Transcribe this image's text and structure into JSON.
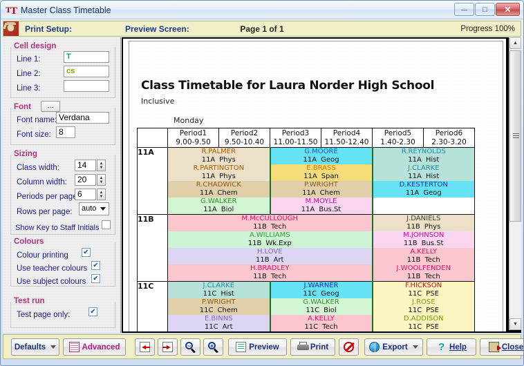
{
  "window": {
    "title": "Master Class Timetable",
    "app_icon": "tt-logo-icon",
    "minimize_glyph": "—",
    "maximize_glyph": "□",
    "close_glyph": "✕"
  },
  "header": {
    "print_setup_label": "Print Setup:",
    "preview_screen_label": "Preview Screen:",
    "page_label": "Page 1 of 1",
    "progress_label": "Progress 100%"
  },
  "sidebar": {
    "cell_design": {
      "title": "Cell design",
      "fields": [
        {
          "label": "Line 1:",
          "value": "T",
          "color": "#00a08a"
        },
        {
          "label": "Line 2:",
          "value": "cs",
          "color": "#8aa000"
        },
        {
          "label": "Line 3:",
          "value": "",
          "color": "#000000"
        }
      ]
    },
    "font": {
      "title": "Font",
      "browse_label": "...",
      "name_label": "Font name:",
      "name_value": "Verdana",
      "size_label": "Font size:",
      "size_value": "8"
    },
    "sizing": {
      "title": "Sizing",
      "class_width_label": "Class width:",
      "class_width_value": "14",
      "column_width_label": "Column width:",
      "column_width_value": "20",
      "periods_label": "Periods per page:",
      "periods_value": "6",
      "rows_label": "Rows per page:",
      "rows_value": "auto",
      "show_key_label": "Show Key to Staff Initials",
      "show_key_checked": false
    },
    "colours": {
      "title": "Colours",
      "items": [
        {
          "label": "Colour printing",
          "checked": true
        },
        {
          "label": "Use teacher colours",
          "checked": true
        },
        {
          "label": "Use subject colours",
          "checked": true
        }
      ]
    },
    "test_run": {
      "title": "Test run",
      "label": "Test page only:",
      "checked": true
    }
  },
  "document": {
    "title": "Class Timetable for Laura Norder High School",
    "subtitle": "Inclusive",
    "day_label": "Monday",
    "periods": [
      {
        "name": "Period1",
        "time": "9.00-9.50"
      },
      {
        "name": "Period2",
        "time": "9.50-10.40"
      },
      {
        "name": "Period3",
        "time": "11.00-11.50"
      },
      {
        "name": "Period4",
        "time": "11.50-12.40"
      },
      {
        "name": "Period5",
        "time": "1.40-2.30"
      },
      {
        "name": "Period6",
        "time": "2.30-3.20"
      }
    ],
    "rows": [
      {
        "class": "11A",
        "blocks": [
          {
            "span": 2,
            "lessons": [
              {
                "teacher": "R.PALMER",
                "class": "11A",
                "subject": "Phys",
                "bg": "#ede0c8",
                "fg": "#a06000"
              },
              {
                "teacher": "R.PARTINGTON",
                "class": "11A",
                "subject": "Phys",
                "bg": "#ede0c8",
                "fg": "#a06000"
              },
              {
                "teacher": "R.CHADWICK",
                "class": "11A",
                "subject": "Chem",
                "bg": "#e0cfa8",
                "fg": "#8a5a10"
              },
              {
                "teacher": "G.WALKER",
                "class": "11A",
                "subject": "Biol",
                "bg": "#d4f5d4",
                "fg": "#2f8f2f"
              }
            ]
          },
          {
            "span": 2,
            "lessons": [
              {
                "teacher": "G.MOORE",
                "class": "11A",
                "subject": "Geog",
                "bg": "#66e2f5",
                "fg": "#1560b0"
              },
              {
                "teacher": "E.BRASS",
                "class": "11A",
                "subject": "Span",
                "bg": "#f5dd7a",
                "fg": "#e07000"
              },
              {
                "teacher": "P.WRIGHT",
                "class": "11A",
                "subject": "Chem",
                "bg": "#e0cfa8",
                "fg": "#8a5a10"
              },
              {
                "teacher": "M.MOYLE",
                "class": "11A",
                "subject": "Bus.St",
                "bg": "#fcd6f0",
                "fg": "#c0109a"
              }
            ]
          },
          {
            "span": 2,
            "lessons": [
              {
                "teacher": "R.REYNOLDS",
                "class": "11A",
                "subject": "Hist",
                "bg": "#b6e2da",
                "fg": "#1e8fa8"
              },
              {
                "teacher": "J.CLARKE",
                "class": "11A",
                "subject": "Hist",
                "bg": "#b6e2da",
                "fg": "#1e8fa8"
              },
              {
                "teacher": "D.KESTERTON",
                "class": "11A",
                "subject": "Geog",
                "bg": "#66e2f5",
                "fg": "#1030c0"
              },
              {
                "teacher": "",
                "class": "",
                "subject": "",
                "bg": "#ffffff",
                "fg": "#ffffff"
              }
            ]
          }
        ]
      },
      {
        "class": "11B",
        "blocks": [
          {
            "span": 4,
            "lessons": [
              {
                "teacher": "M.McCULLOUGH",
                "class": "11B",
                "subject": "Tech",
                "bg": "#fcc6cf",
                "fg": "#e01070"
              },
              {
                "teacher": "A.WILLIAMS",
                "class": "11B",
                "subject": "Wk.Exp",
                "bg": "#cdf3d5",
                "fg": "#3a9a3a"
              },
              {
                "teacher": "H.LOVE",
                "class": "11B",
                "subject": "Art",
                "bg": "#ded5f5",
                "fg": "#7a6ab0"
              },
              {
                "teacher": "H.BRADLEY",
                "class": "11B",
                "subject": "Tech",
                "bg": "#fcc6cf",
                "fg": "#e01070"
              }
            ]
          },
          {
            "span": 2,
            "lessons": [
              {
                "teacher": "J.DANIELS",
                "class": "11B",
                "subject": "Phys",
                "bg": "#ede0c8",
                "fg": "#3a3a3a"
              },
              {
                "teacher": "M.JOHNSON",
                "class": "11B",
                "subject": "Bus.St",
                "bg": "#fcd6f0",
                "fg": "#c0109a"
              },
              {
                "teacher": "A.KELLY",
                "class": "11B",
                "subject": "Tech",
                "bg": "#fcc6cf",
                "fg": "#e01070"
              },
              {
                "teacher": "J.WOOLFENDEN",
                "class": "11B",
                "subject": "Tech",
                "bg": "#fcc6cf",
                "fg": "#e01070"
              }
            ]
          }
        ]
      },
      {
        "class": "11C",
        "blocks": [
          {
            "span": 2,
            "lessons": [
              {
                "teacher": "J.CLARKE",
                "class": "11C",
                "subject": "Hist",
                "bg": "#b6e2da",
                "fg": "#1e8fa8"
              },
              {
                "teacher": "P.WRIGHT",
                "class": "11C",
                "subject": "Chem",
                "bg": "#e0cfa8",
                "fg": "#8a5a10"
              },
              {
                "teacher": "E.BINNS",
                "class": "11C",
                "subject": "Art",
                "bg": "#ded5f5",
                "fg": "#7a6ab0"
              }
            ]
          },
          {
            "span": 2,
            "lessons": [
              {
                "teacher": "J.WARNER",
                "class": "11C",
                "subject": "Geog",
                "bg": "#66e2f5",
                "fg": "#1030c0"
              },
              {
                "teacher": "G.WALKER",
                "class": "11C",
                "subject": "Biol",
                "bg": "#d4f5d4",
                "fg": "#2f8f2f"
              },
              {
                "teacher": "A.KELLY",
                "class": "11C",
                "subject": "Tech",
                "bg": "#fcc6cf",
                "fg": "#e01070"
              }
            ]
          },
          {
            "span": 2,
            "lessons": [
              {
                "teacher": "F.HICKSON",
                "class": "11C",
                "subject": "PSE",
                "bg": "#fcf5c0",
                "fg": "#d01010"
              },
              {
                "teacher": "J.ROSE",
                "class": "11C",
                "subject": "PSE",
                "bg": "#fcf5c0",
                "fg": "#7a9a10"
              },
              {
                "teacher": "D.ADDISON",
                "class": "11C",
                "subject": "PSE",
                "bg": "#fcf5c0",
                "fg": "#7a9a10"
              }
            ]
          }
        ]
      }
    ]
  },
  "scrollbar": {
    "up_glyph": "▲",
    "down_glyph": "▼"
  },
  "toolbar": {
    "defaults_label": "Defaults",
    "advanced_label": "Advanced",
    "prev_page_icon": "arrow-left-icon",
    "next_page_icon": "arrow-right-icon",
    "zoom_out_icon": "magnifier-minus-icon",
    "zoom_in_icon": "magnifier-plus-icon",
    "preview_label": "Preview",
    "print_label": "Print",
    "cancel_icon": "no-entry-icon",
    "export_label": "Export",
    "help_label": "Help",
    "close_label": "Close"
  }
}
